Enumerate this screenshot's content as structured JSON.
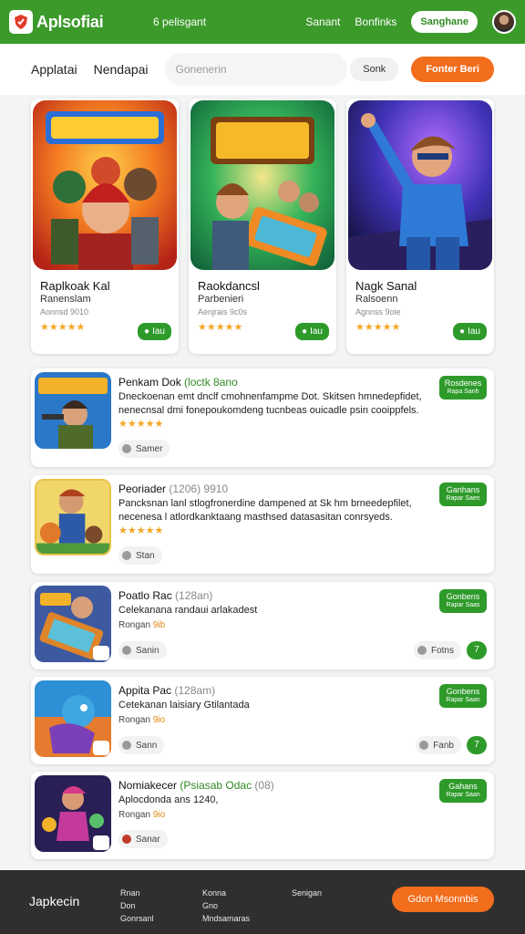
{
  "header": {
    "logo_text": "Aplsofiai",
    "nav_link": "6 pelisgant",
    "link_a": "Sanant",
    "link_b": "Bonfinks",
    "pill": "Sanghane"
  },
  "subnav": {
    "tab1": "Applatai",
    "tab2": "Nendapai",
    "search_placeholder": "Gonenerin",
    "ghost_button": "Sonk",
    "orange_button": "Fonter Beri"
  },
  "featured": [
    {
      "title": "Raplkoak Kal",
      "subtitle": "Ranenslam",
      "meta": "Aonnsd 9010",
      "stars": "★★★★★",
      "button": "Iau"
    },
    {
      "title": "Raokdancsl",
      "subtitle": "Parbenieri",
      "meta": "Aenjrais 9c0s",
      "stars": "★★★★★",
      "button": "Iau"
    },
    {
      "title": "Nagk Sanal",
      "subtitle": "Ralsoenn",
      "meta": "Agnnss 9oie",
      "stars": "★★★★★",
      "button": "Iau"
    }
  ],
  "list": [
    {
      "title": "Penkam Dok",
      "tag": "(loctk 8ano",
      "tag_gray": "",
      "desc": "Dneckoenan emt dnclf cmohnenfampme Dot. Skitsen hmnedepfidet, nenecnsal dmi fonepoukomdeng tucnbeas ouicadle psin cooippfels.",
      "stars": "★★★★★",
      "rating_label": "",
      "rating_accent": "",
      "pill": "Samer",
      "btn_main": "Rosdenes",
      "btn_sub": "Rapa Sanh",
      "side_pill": "",
      "side_dot": ""
    },
    {
      "title": "Peoriader",
      "tag": "",
      "tag_gray": "(1206) 9910",
      "desc": "Pancksnan lanl stlogfronerdine dampened at Sk hm brneedepfilet, necenesa l atlordkanktaang masthsed datasasitan conrsyeds.",
      "stars": "★★★★★",
      "rating_label": "",
      "rating_accent": "",
      "pill": "Stan",
      "btn_main": "Ganhans",
      "btn_sub": "Rapar Saen",
      "side_pill": "",
      "side_dot": ""
    },
    {
      "title": "Poatlo Rac",
      "tag": "",
      "tag_gray": "(128an)",
      "desc": "Celekanana randaui arlakadest",
      "stars": "",
      "rating_label": "Rongan",
      "rating_accent": "9ib",
      "pill": "Sanin",
      "btn_main": "Gonbens",
      "btn_sub": "Rapar Saas",
      "side_pill": "Fotns",
      "side_dot": "7"
    },
    {
      "title": "Appita Pac",
      "tag": "",
      "tag_gray": "(128am)",
      "desc": "Cetekanan laisiary Gtilantada",
      "stars": "",
      "rating_label": "Rongan",
      "rating_accent": "9io",
      "pill": "Sann",
      "btn_main": "Gonbens",
      "btn_sub": "Rapar Saan",
      "side_pill": "Fanb",
      "side_dot": "7"
    },
    {
      "title": "Nomiakecer",
      "tag": "(Psiasab Odac",
      "tag_gray": "(08)",
      "desc": "Aplocdonda ans 1240,",
      "stars": "",
      "rating_label": "Rongan",
      "rating_accent": "9io",
      "pill": "Sanar",
      "btn_main": "Gahans",
      "btn_sub": "Rapar Saan",
      "side_pill": "",
      "side_dot": ""
    }
  ],
  "footer": {
    "brand": "Japkecin",
    "col1": [
      "Rnan",
      "Don",
      "Gonrsanl"
    ],
    "col2": [
      "Konna",
      "Gno",
      "Mndsamaras"
    ],
    "col3": [
      "Senigan"
    ],
    "cta": "Gdon Msonnbis"
  },
  "colors": {
    "brand_green": "#3c9a2b",
    "accent_orange": "#f26d1c",
    "star": "#f5a623"
  }
}
